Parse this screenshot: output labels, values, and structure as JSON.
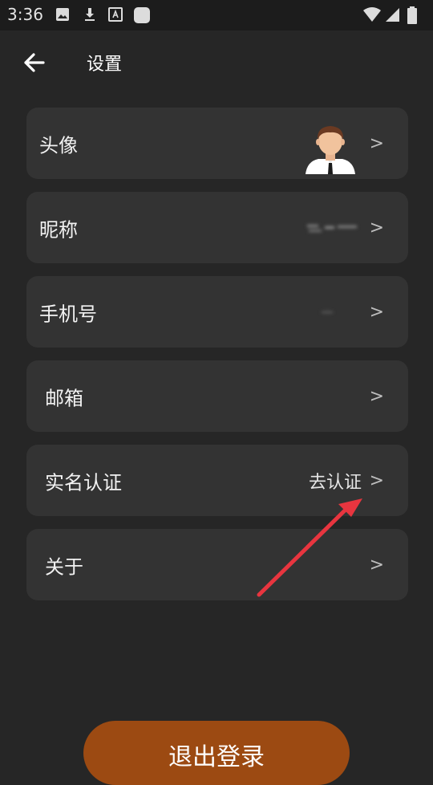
{
  "status_bar": {
    "time": "3:36",
    "icons": [
      "image-icon",
      "download-icon",
      "font-icon",
      "app-icon",
      "wifi-icon",
      "signal-icon",
      "battery-icon"
    ]
  },
  "header": {
    "title": "设置",
    "back_icon": "arrow-left-icon"
  },
  "settings": {
    "avatar": {
      "label": "头像",
      "chevron": ">"
    },
    "nickname": {
      "label": "昵称",
      "chevron": ">"
    },
    "phone": {
      "label": "手机号",
      "chevron": ">"
    },
    "email": {
      "label": "邮箱",
      "chevron": ">"
    },
    "verification": {
      "label": "实名认证",
      "value": "去认证",
      "chevron": ">"
    },
    "about": {
      "label": "关于",
      "chevron": ">"
    }
  },
  "logout": {
    "label": "退出登录"
  },
  "colors": {
    "background": "#262626",
    "row": "#333333",
    "accent": "#9c4a12",
    "annotation": "#e8353f"
  }
}
